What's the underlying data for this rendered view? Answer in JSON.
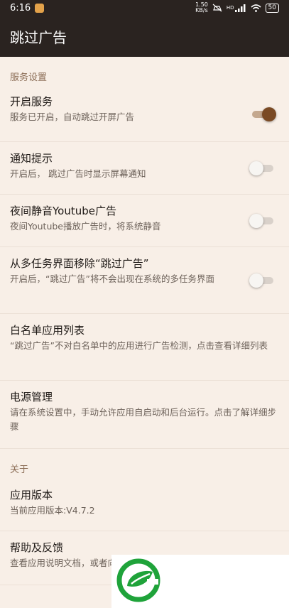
{
  "status_bar": {
    "time": "6:16",
    "net_speed_value": "1.50",
    "net_speed_unit": "KB/s",
    "network_label": "HD",
    "battery": "50"
  },
  "app_bar": {
    "title": "跳过广告"
  },
  "sections": {
    "service": {
      "title": "服务设置",
      "items": [
        {
          "title": "开启服务",
          "subtitle": "服务已开启，自动跳过开屏广告",
          "toggle": true
        },
        {
          "title": "通知提示",
          "subtitle": "开启后， 跳过广告时显示屏幕通知",
          "toggle": false
        },
        {
          "title": "夜间静音Youtube广告",
          "subtitle": "夜间Youtube播放广告时，将系统静音",
          "toggle": false
        },
        {
          "title": "从多任务界面移除“跳过广告”",
          "subtitle": "开启后，“跳过广告”将不会出现在系统的多任务界面",
          "toggle": false
        },
        {
          "title": "白名单应用列表",
          "subtitle": "“跳过广告”不对白名单中的应用进行广告检测，点击查看详细列表"
        },
        {
          "title": "电源管理",
          "subtitle": "请在系统设置中，手动允许应用自启动和后台运行。点击了解详细步骤"
        }
      ]
    },
    "about": {
      "title": "关于",
      "items": [
        {
          "title": "应用版本",
          "subtitle": "当前应用版本:V4.7.2"
        },
        {
          "title": "帮助及反馈",
          "subtitle": "查看应用说明文档，或者向作者提交反馈"
        }
      ]
    }
  },
  "icons": {
    "app_notification": "app-notification-icon",
    "mute": "mute-icon",
    "signal": "signal-icon",
    "wifi": "wifi-icon",
    "watermark": "leaf-logo-icon"
  },
  "colors": {
    "bar_background": "#2a2320",
    "page_background": "#f8efe7",
    "accent": "#7a4a24",
    "section_title": "#8c6e57",
    "logo_green": "#1fa33a"
  }
}
